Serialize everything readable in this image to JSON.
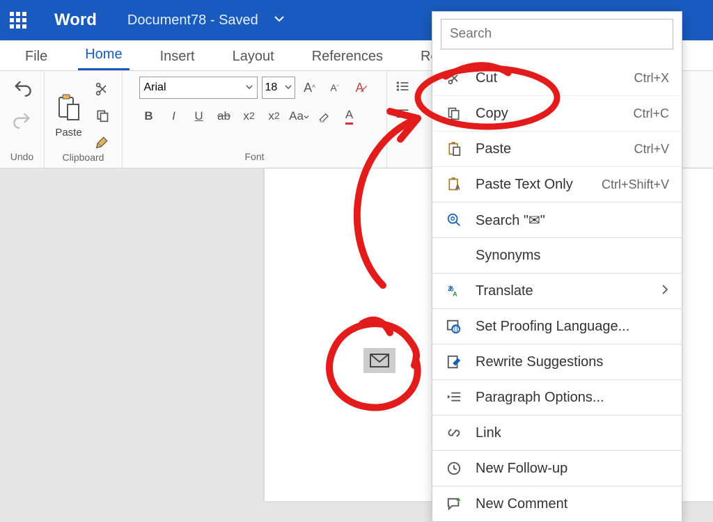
{
  "title_bar": {
    "app_name": "Word",
    "doc_name": "Document78  -  Saved"
  },
  "tabs": {
    "file": "File",
    "home": "Home",
    "insert": "Insert",
    "layout": "Layout",
    "references": "References",
    "review": "Review"
  },
  "ribbon": {
    "undo_label": "Undo",
    "clipboard_label": "Clipboard",
    "paste": "Paste",
    "font_label": "Font",
    "font_name": "Arial",
    "font_size": "18",
    "aa": "Aa"
  },
  "ctx": {
    "search_placeholder": "Search",
    "cut": "Cut",
    "cut_sc": "Ctrl+X",
    "copy": "Copy",
    "copy_sc": "Ctrl+C",
    "paste": "Paste",
    "paste_sc": "Ctrl+V",
    "paste_text": "Paste Text Only",
    "paste_text_sc": "Ctrl+Shift+V",
    "search_sel": "Search \"✉\"",
    "synonyms": "Synonyms",
    "translate": "Translate",
    "proofing": "Set Proofing Language...",
    "rewrite": "Rewrite Suggestions",
    "para": "Paragraph Options...",
    "link": "Link",
    "followup": "New Follow-up",
    "comment": "New Comment"
  }
}
